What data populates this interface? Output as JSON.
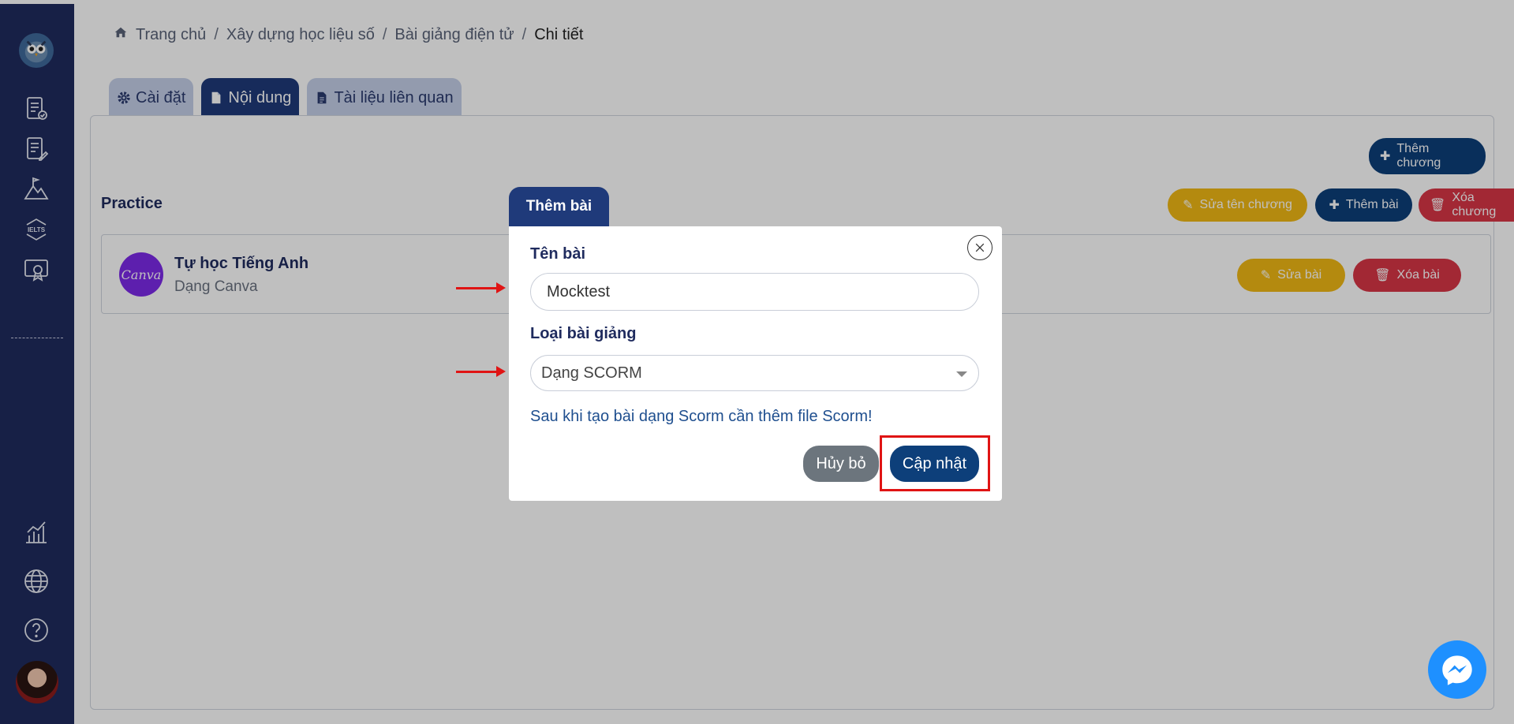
{
  "breadcrumb": {
    "home": "Trang chủ",
    "item1": "Xây dựng học liệu số",
    "item2": "Bài giảng điện tử",
    "current": "Chi tiết",
    "separator": "/"
  },
  "tabs": [
    {
      "label": "Cài đặt",
      "icon": "gear-icon"
    },
    {
      "label": "Nội dung",
      "icon": "file-icon"
    },
    {
      "label": "Tài liệu liên quan",
      "icon": "file-text-icon"
    }
  ],
  "toolbar": {
    "add_chapter": "Thêm chương",
    "rename_chapter": "Sửa tên chương",
    "add_lesson": "Thêm bài",
    "delete_chapter": "Xóa chương"
  },
  "chapter": {
    "title": "Practice",
    "lesson": {
      "logo_text": "Canva",
      "name": "Tự học Tiếng Anh",
      "type": "Dạng Canva",
      "edit": "Sửa bài",
      "delete": "Xóa bài"
    }
  },
  "modal": {
    "title": "Thêm bài",
    "name_label": "Tên bài",
    "name_value": "Mocktest",
    "type_label": "Loại bài giảng",
    "type_value": "Dạng SCORM",
    "note": "Sau khi tạo bài dạng Scorm cần thêm file Scorm!",
    "cancel": "Hủy bỏ",
    "update": "Cập nhật"
  },
  "sidebar": {
    "icons": [
      "owl-logo-icon",
      "document-check-icon",
      "document-edit-icon",
      "mountain-flag-icon",
      "ielts-icon",
      "certificate-icon",
      "chart-icon",
      "globe-icon",
      "help-icon",
      "user-avatar"
    ],
    "ielts_text": "IELTS"
  },
  "colors": {
    "sidebar": "#1f2b5e",
    "navy": "#0d3f7a",
    "yellow": "#f0b915",
    "red": "#d93646",
    "annotation": "#e01414"
  }
}
